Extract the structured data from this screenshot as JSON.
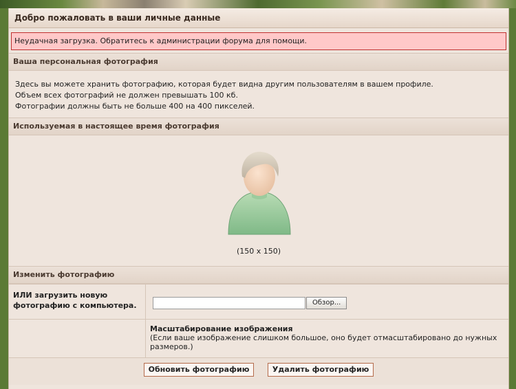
{
  "page": {
    "title": "Добро пожаловать в ваши личные данные",
    "error_message": "Неудачная загрузка. Обратитесь к администрации форума для помощи."
  },
  "personal_photo": {
    "heading": "Ваша персональная фотография",
    "lines": [
      "Здесь вы можете хранить фотографию, которая будет видна другим пользователям в вашем профиле.",
      "Объем всех фотографий не должен превышать 100 кб.",
      "Фотографии должны быть не больше 400 на 400 пикселей."
    ]
  },
  "current_photo": {
    "heading": "Используемая в настоящее время фотография",
    "dimensions": "(150 x 150)",
    "icon": "default-avatar-icon"
  },
  "change_photo": {
    "heading": "Изменить фотографию",
    "upload_label": "ИЛИ загрузить новую фотографию с компьютера.",
    "file_value": "",
    "browse_label": "Обзор...",
    "scale_title": "Масштабирование изображения",
    "scale_note": "(Если ваше изображение слишком большое, оно будет отмасштабировано до нужных размеров.)"
  },
  "actions": {
    "update_label": "Обновить фотографию",
    "delete_label": "Удалить фотографию"
  },
  "colors": {
    "error_bg": "#ffc8c8",
    "error_border": "#c0302f",
    "panel_bg": "#efe5dd",
    "button_border": "#b46a4a"
  }
}
